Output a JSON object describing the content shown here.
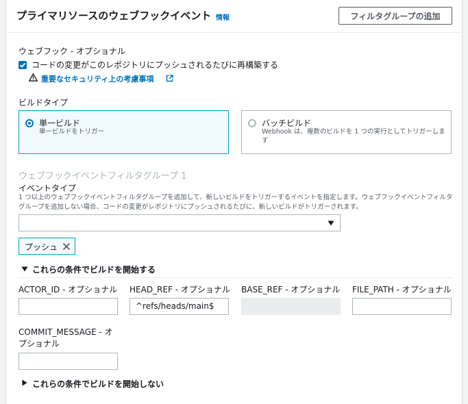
{
  "header": {
    "title": "プライマリソースのウェブフックイベント",
    "info": "情報",
    "add_filter_group": "フィルタグループの追加"
  },
  "webhook": {
    "label": "ウェブフック - オプショナル",
    "checkbox_label": "コードの変更がこのレポジトリにプッシュされるたびに再構築する",
    "checked": true,
    "security_link": "重要なセキュリティ上の考慮事項"
  },
  "build_type": {
    "label": "ビルドタイプ",
    "options": [
      {
        "title": "単一ビルド",
        "desc": "単一ビルドをトリガー",
        "selected": true
      },
      {
        "title": "バッチビルド",
        "desc": "Webhook は、複数のビルドを 1 つの実行としてトリガーします",
        "selected": false
      }
    ]
  },
  "filter_group": {
    "title": "ウェブフックイベントフィルタグループ 1",
    "event_type_label": "イベントタイプ",
    "event_type_desc": "1 つ以上のウェブフックイベントフィルタグループを追加して、新しいビルドをトリガーするイベントを指定します。ウェブフックイベントフィルタグループを追加しない場合、コードの変更がレポジトリにプッシュされるたびに、新しいビルドがトリガーされます。",
    "select_value": "",
    "tokens": [
      "プッシュ"
    ]
  },
  "start_conditions": {
    "label": "これらの条件でビルドを開始する",
    "expanded": true,
    "fields": [
      {
        "label": "ACTOR_ID - オプショナル",
        "value": ""
      },
      {
        "label": "HEAD_REF - オプショナル",
        "value": "^refs/heads/main$"
      },
      {
        "label": "BASE_REF - オプショナル",
        "value": ""
      },
      {
        "label": "FILE_PATH - オプショナル",
        "value": ""
      },
      {
        "label": "COMMIT_MESSAGE - オプショナル",
        "value": ""
      }
    ]
  },
  "skip_conditions": {
    "label": "これらの条件でビルドを開始しない",
    "expanded": false
  },
  "colors": {
    "link": "#0073bb",
    "selected_border": "#00a1c9",
    "selected_bg": "#f1faff"
  }
}
